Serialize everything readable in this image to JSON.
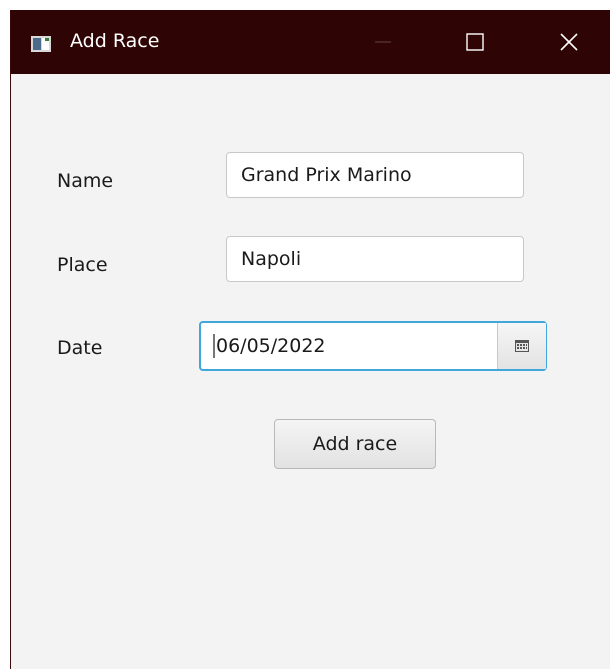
{
  "window": {
    "title": "Add Race",
    "controls": {
      "minimize": "minimize-icon",
      "maximize": "maximize-icon",
      "close": "close-icon"
    },
    "titlebar_color": "#2f0404"
  },
  "form": {
    "name_label": "Name",
    "name_value": "Grand Prix Marino",
    "place_label": "Place",
    "place_value": "Napoli",
    "date_label": "Date",
    "date_value": "06/05/2022",
    "calendar_icon": "calendar-icon",
    "focus_color": "#3fa7dc"
  },
  "actions": {
    "add_label": "Add race"
  }
}
